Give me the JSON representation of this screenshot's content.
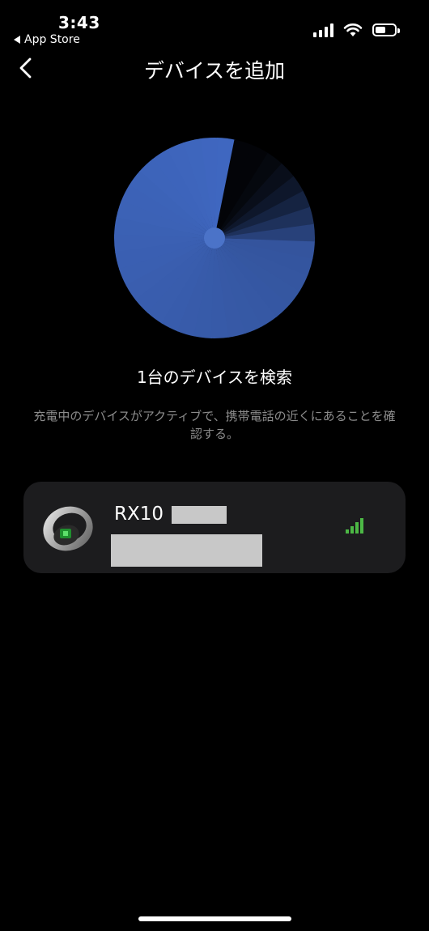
{
  "status_bar": {
    "time": "3:43",
    "back_app_label": "App Store",
    "battery_level": 0.55
  },
  "nav": {
    "title": "デバイスを追加"
  },
  "scan": {
    "title": "1台のデバイスを検索",
    "hint": "充電中のデバイスがアクティブで、携帯電話の近くにあることを確認する。"
  },
  "device": {
    "name": "RX10",
    "signal_strength": 4
  },
  "colors": {
    "background": "#000000",
    "radar_blue": "#3f67c0",
    "signal_green": "#4cb845",
    "card_bg": "#1c1c1e",
    "hint_gray": "#8c8c8c"
  }
}
